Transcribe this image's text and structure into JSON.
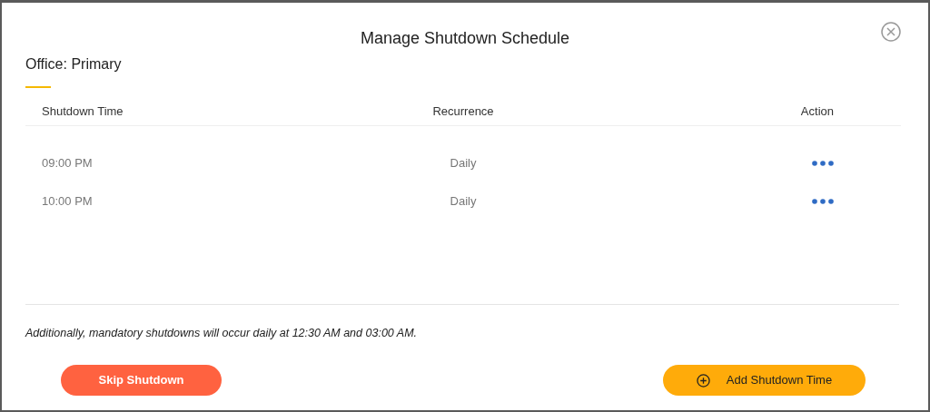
{
  "dialog": {
    "title": "Manage Shutdown Schedule",
    "office": "Office: Primary"
  },
  "table": {
    "columns": [
      "Shutdown Time",
      "Recurrence",
      "Action"
    ],
    "rows": [
      {
        "time": "09:00 PM",
        "recurrence": "Daily"
      },
      {
        "time": "10:00 PM",
        "recurrence": "Daily"
      }
    ]
  },
  "note": "Additionally, mandatory shutdowns will occur daily at 12:30 AM and 03:00 AM.",
  "buttons": {
    "skip": "Skip Shutdown",
    "add": "Add Shutdown Time"
  }
}
